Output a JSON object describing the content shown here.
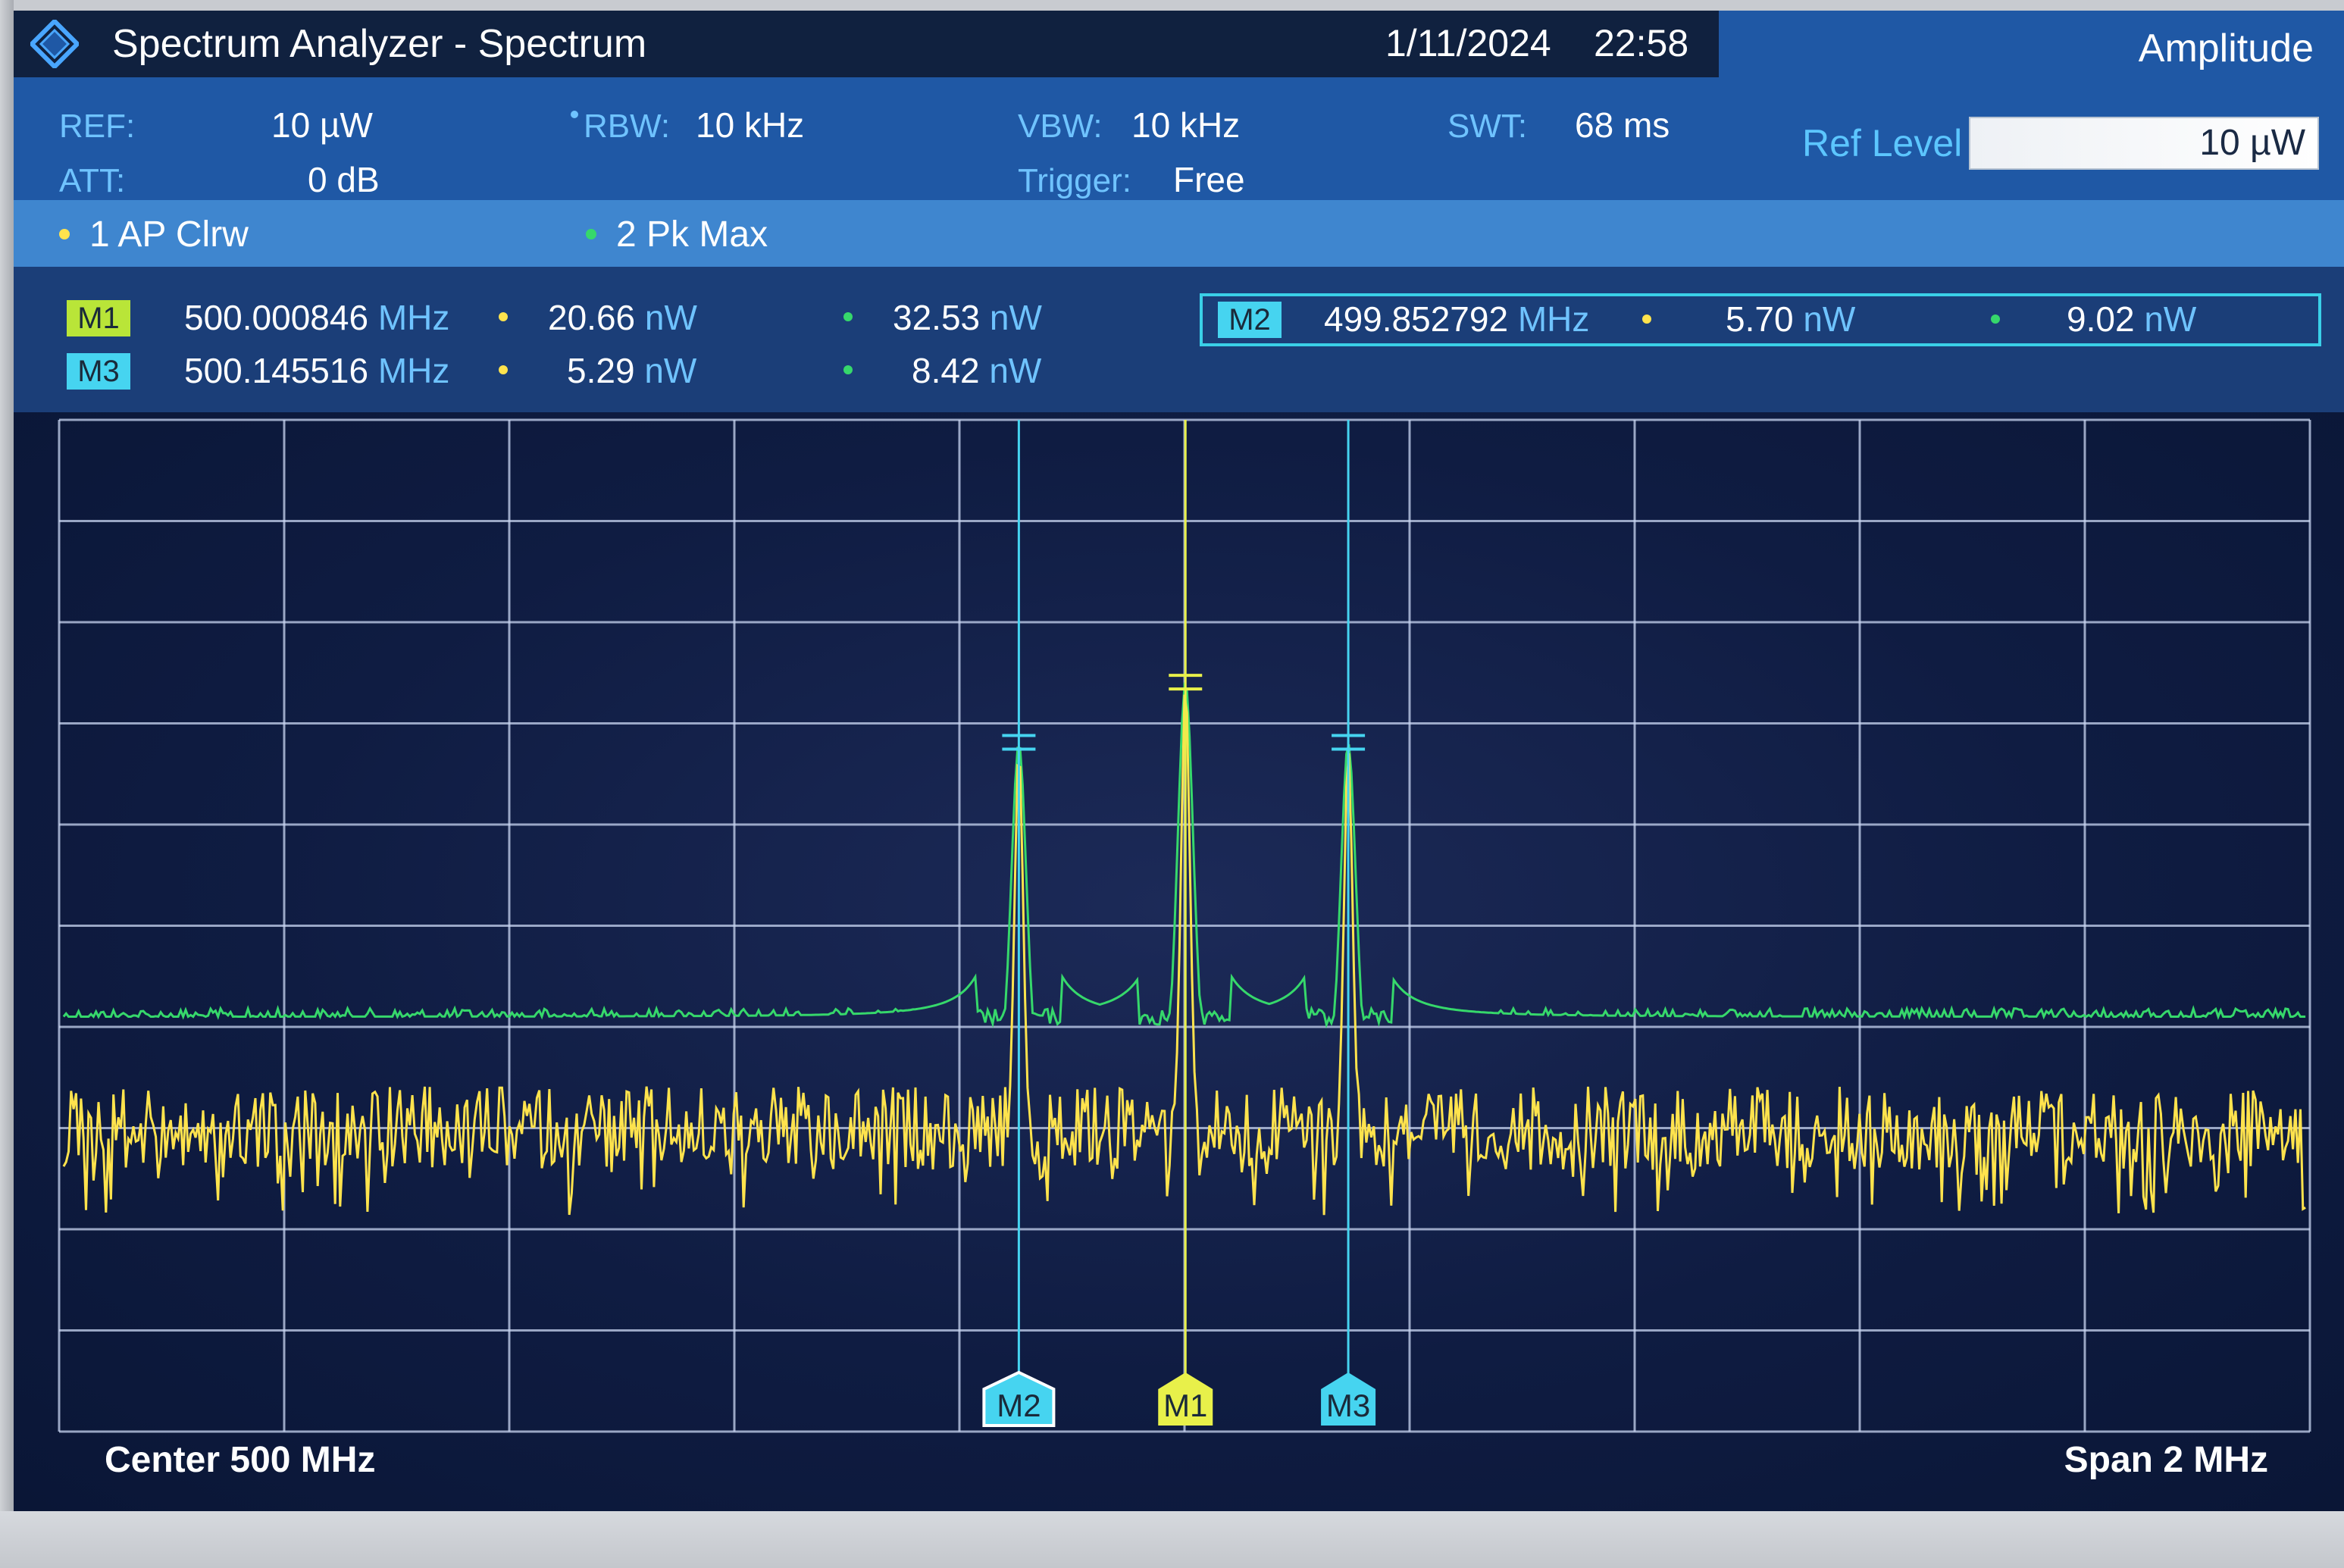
{
  "window": {
    "title": "Spectrum Analyzer - Spectrum",
    "date": "1/11/2024",
    "time": "22:58"
  },
  "right_panel": {
    "title": "Amplitude",
    "ref_level_label": "Ref Level",
    "ref_level_value": "10 µW"
  },
  "params": {
    "ref_label": "REF:",
    "ref_value": "10 µW",
    "att_label": "ATT:",
    "att_value": "0 dB",
    "rbw_label": "RBW:",
    "rbw_value": "10 kHz",
    "vbw_label": "VBW:",
    "vbw_value": "10 kHz",
    "trigger_label": "Trigger:",
    "trigger_value": "Free",
    "swt_label": "SWT:",
    "swt_value": "68 ms"
  },
  "traces": [
    {
      "label": "1 AP  Clrw",
      "color": "#ffe34d"
    },
    {
      "label": "2 Pk  Max",
      "color": "#36d86b"
    }
  ],
  "markers": [
    {
      "id": "M1",
      "freq": "500.000846",
      "freq_unit": "MHz",
      "val1": "20.66",
      "val2": "32.53",
      "unit": "nW",
      "color": "#b9e538"
    },
    {
      "id": "M3",
      "freq": "500.145516",
      "freq_unit": "MHz",
      "val1": "5.29",
      "val2": "8.42",
      "unit": "nW",
      "color": "#46d4f0"
    },
    {
      "id": "M2",
      "freq": "499.852792",
      "freq_unit": "MHz",
      "val1": "5.70",
      "val2": "9.02",
      "unit": "nW",
      "color": "#46d4f0"
    }
  ],
  "chart_data": {
    "type": "line",
    "x_center_mhz": 500,
    "x_span_mhz": 2,
    "xlim": [
      499,
      501
    ],
    "grid": true,
    "series": [
      {
        "name": "1 AP  Clrw",
        "color": "#ffe34d",
        "peaks_mhz": [
          499.852792,
          500.000846,
          500.145516
        ]
      },
      {
        "name": "2 Pk  Max",
        "color": "#36d86b",
        "peaks_mhz": [
          499.852792,
          500.000846,
          500.145516
        ]
      }
    ],
    "marker_labels": [
      "M2",
      "M1",
      "M3"
    ],
    "footer": {
      "left": "Center 500 MHz",
      "right": "Span 2 MHz"
    }
  }
}
